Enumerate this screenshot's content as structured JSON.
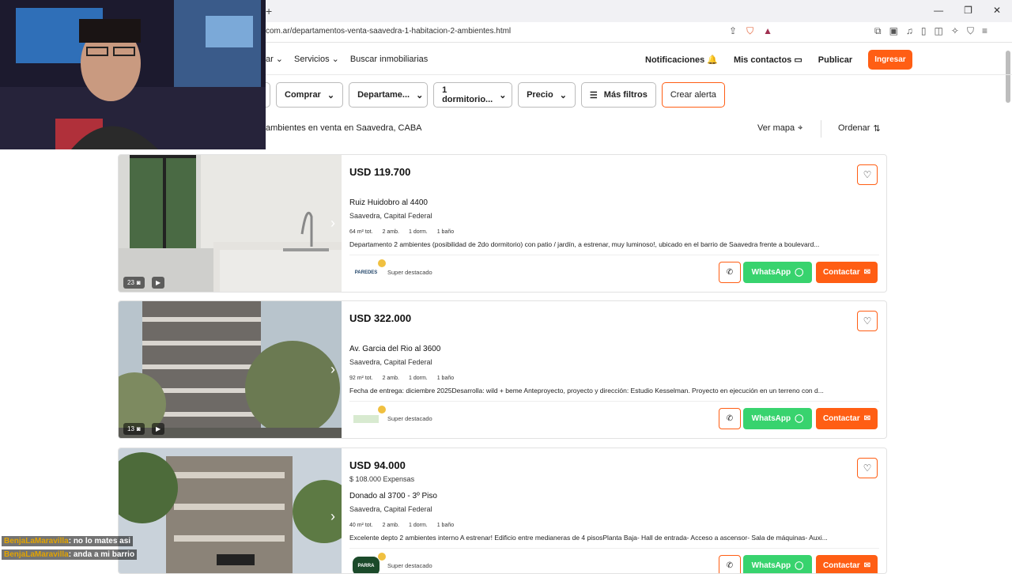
{
  "browser": {
    "url": "com.ar/departamentos-venta-saavedra-1-habitacion-2-ambientes.html"
  },
  "nav": {
    "left_items": [
      "ar",
      "Servicios",
      "Buscar inmobiliarias"
    ],
    "notifications": "Notificaciones",
    "contacts": "Mis contactos",
    "publish": "Publicar",
    "login": "Ingresar"
  },
  "filters": {
    "operation": "Comprar",
    "property_type": "Departame...",
    "rooms": "1 dormitorio...",
    "price": "Precio",
    "more": "Más filtros",
    "alert": "Crear alerta"
  },
  "results": {
    "title": "ambientes en venta en Saavedra, CABA",
    "map": "Ver mapa",
    "order": "Ordenar"
  },
  "listings": [
    {
      "price": "USD 119.700",
      "expensas": "",
      "address": "Ruiz Huidobro al 4400",
      "location": "Saavedra, Capital Federal",
      "features": [
        "64 m² tot.",
        "2 amb.",
        "1 dorm.",
        "1 baño"
      ],
      "description": "Departamento 2 ambientes (posibilidad de 2do dormitorio) con patio / jardín, a estrenar, muy luminoso!, ubicado en el barrio de Saavedra frente a boulevard...",
      "photos": "23",
      "logo": "PAREDES",
      "tier": "Super destacado",
      "whatsapp": "WhatsApp",
      "contact": "Contactar"
    },
    {
      "price": "USD 322.000",
      "expensas": "",
      "address": "Av. Garcia del Rio al 3600",
      "location": "Saavedra, Capital Federal",
      "features": [
        "92 m² tot.",
        "2 amb.",
        "1 dorm.",
        "1 baño"
      ],
      "description": "Fecha de entrega: diciembre 2025Desarrolla: wild + beme Anteproyecto, proyecto y dirección: Estudio Kesselman. Proyecto en ejecución en un terreno con d...",
      "photos": "13",
      "logo": "",
      "tier": "Super destacado",
      "whatsapp": "WhatsApp",
      "contact": "Contactar"
    },
    {
      "price": "USD 94.000",
      "expensas": "$ 108.000 Expensas",
      "address": "Donado al 3700 - 3º Piso",
      "location": "Saavedra, Capital Federal",
      "features": [
        "40 m² tot.",
        "2 amb.",
        "1 dorm.",
        "1 baño"
      ],
      "description": "Excelente depto 2 ambientes interno A estrenar! Edificio entre medianeras de 4 pisosPlanta Baja- Hall de entrada- Acceso a ascensor- Sala de máquinas- Auxi...",
      "photos": "",
      "logo": "PARRA",
      "tier": "Super destacado",
      "whatsapp": "WhatsApp",
      "contact": "Contactar"
    }
  ],
  "chat": [
    {
      "user": "BenjaLaMaravilla",
      "msg": ": no lo mates asi"
    },
    {
      "user": "BenjaLaMaravilla",
      "msg": ": anda a mi barrio"
    }
  ],
  "colors": {
    "accent": "#ff5e14",
    "whatsapp": "#38d36e"
  }
}
